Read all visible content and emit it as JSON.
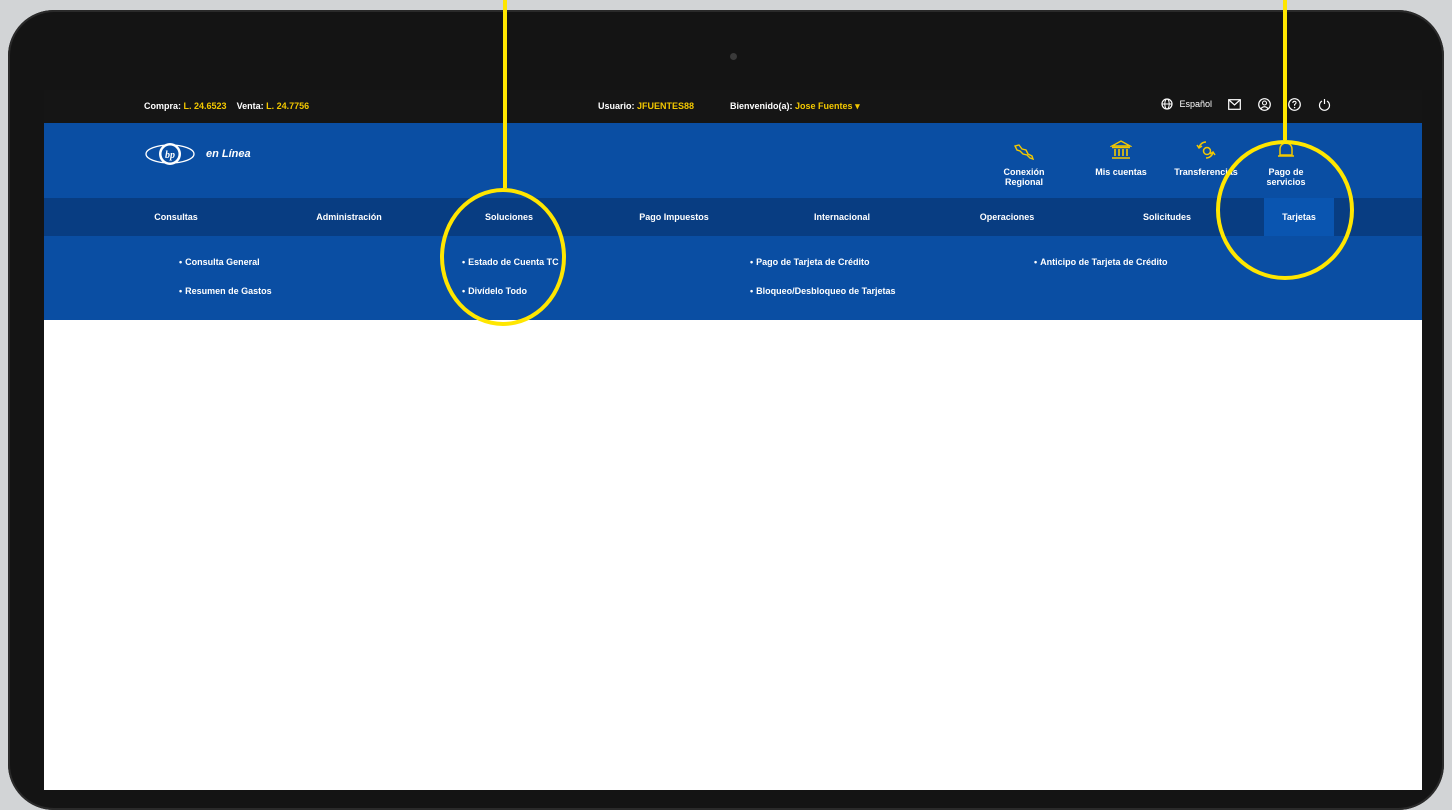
{
  "rates": {
    "buy_label": "Compra:",
    "buy_value": "L. 24.6523",
    "sell_label": "Venta:",
    "sell_value": "L. 24.7756"
  },
  "user": {
    "user_label": "Usuario:",
    "user_value": "JFUENTES88",
    "welcome_label": "Bienvenido(a):",
    "welcome_name": "Jose Fuentes",
    "dropdown_glyph": "▾"
  },
  "top_actions": {
    "language": "Español",
    "icons": [
      "globe-icon",
      "mail-icon",
      "user-circle-icon",
      "help-icon",
      "power-icon"
    ]
  },
  "header": {
    "logo_text": "en Línea",
    "quick_links": [
      {
        "label_line1": "Conexión",
        "label_line2": "Regional",
        "icon": "map-icon"
      },
      {
        "label_line1": "Mis cuentas",
        "label_line2": "",
        "icon": "bank-icon"
      },
      {
        "label_line1": "Transferencias",
        "label_line2": "",
        "icon": "transfer-icon"
      },
      {
        "label_line1": "Pago de",
        "label_line2": "servicios",
        "icon": "bell-icon"
      }
    ]
  },
  "main_nav": [
    {
      "label": "Consultas"
    },
    {
      "label": "Administración"
    },
    {
      "label": "Soluciones"
    },
    {
      "label": "Pago Impuestos"
    },
    {
      "label": "Internacional"
    },
    {
      "label": "Operaciones"
    },
    {
      "label": "Solicitudes"
    },
    {
      "label": "Tarjetas",
      "active": true
    }
  ],
  "submenu": [
    {
      "label": "Consulta General"
    },
    {
      "label": "Resumen de Gastos"
    },
    {
      "label": "Estado de Cuenta TC"
    },
    {
      "label": "Divídelo Todo"
    },
    {
      "label": "Pago de Tarjeta de Crédito"
    },
    {
      "label": "Bloqueo/Desbloqueo de Tarjetas"
    },
    {
      "label": "Anticipo de Tarjeta de Crédito"
    }
  ],
  "colors": {
    "topbar": "#151515",
    "header_blue": "#0a4ea3",
    "nav_blue": "#083d82",
    "highlight_yellow": "#ffe600",
    "accent_text": "#f3c800"
  }
}
